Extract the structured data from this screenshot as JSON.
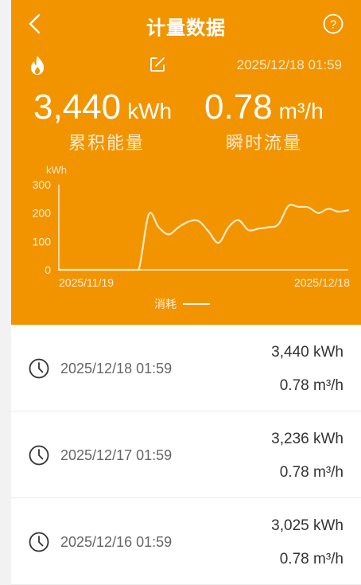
{
  "nav": {
    "title": "计量数据"
  },
  "summary": {
    "timestamp": "2025/12/18 01:59",
    "energy": {
      "value": "3,440",
      "unit": "kWh",
      "label": "累积能量"
    },
    "flow": {
      "value": "0.78",
      "unit": "m³/h",
      "label": "瞬时流量"
    }
  },
  "chart_data": {
    "type": "line",
    "ylabel": "kWh",
    "ylim": [
      0,
      300
    ],
    "yticks": [
      "300",
      "200",
      "100",
      "0"
    ],
    "x_tick_labels": [
      "2025/11/19",
      "2025/12/18"
    ],
    "series": [
      {
        "name": "消耗",
        "x": [
          "2025/11/19",
          "2025/11/20",
          "2025/11/21",
          "2025/11/22",
          "2025/11/23",
          "2025/11/24",
          "2025/11/25",
          "2025/11/26",
          "2025/11/27",
          "2025/11/28",
          "2025/11/29",
          "2025/11/30",
          "2025/12/01",
          "2025/12/02",
          "2025/12/03",
          "2025/12/04",
          "2025/12/05",
          "2025/12/06",
          "2025/12/07",
          "2025/12/08",
          "2025/12/09",
          "2025/12/10",
          "2025/12/11",
          "2025/12/12",
          "2025/12/13",
          "2025/12/14",
          "2025/12/15",
          "2025/12/16",
          "2025/12/17",
          "2025/12/18"
        ],
        "values": [
          0,
          0,
          0,
          0,
          0,
          0,
          0,
          0,
          0,
          195,
          150,
          125,
          150,
          170,
          172,
          135,
          95,
          150,
          175,
          140,
          145,
          150,
          160,
          225,
          222,
          220,
          200,
          215,
          205,
          210
        ]
      }
    ],
    "grid": false
  },
  "legend": {
    "label": "消耗"
  },
  "records": [
    {
      "date": "2025/12/18 01:59",
      "energy": "3,440 kWh",
      "flow": "0.78 m³/h"
    },
    {
      "date": "2025/12/17 01:59",
      "energy": "3,236 kWh",
      "flow": "0.78 m³/h"
    },
    {
      "date": "2025/12/16 01:59",
      "energy": "3,025 kWh",
      "flow": "0.78 m³/h"
    }
  ],
  "colors": {
    "accent": "#f29400",
    "background": "#f2f2f2"
  },
  "icons": {
    "back": "chevron-left-icon",
    "help": "help-circle-icon",
    "flame": "flame-icon",
    "edit": "edit-icon",
    "clock": "clock-icon"
  }
}
